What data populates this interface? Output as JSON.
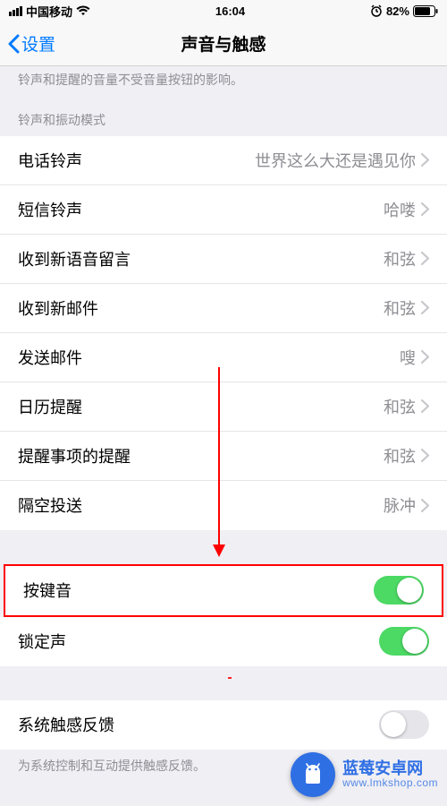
{
  "status": {
    "carrier": "中国移动",
    "time": "16:04",
    "battery_pct": "82%"
  },
  "nav": {
    "back_label": "设置",
    "title": "声音与触感"
  },
  "desc_top": "铃声和提醒的音量不受音量按钮的影响。",
  "section1_header": "铃声和振动模式",
  "rows": {
    "ringtone": {
      "label": "电话铃声",
      "value": "世界这么大还是遇见你"
    },
    "text_tone": {
      "label": "短信铃声",
      "value": "哈喽"
    },
    "voicemail": {
      "label": "收到新语音留言",
      "value": "和弦"
    },
    "new_mail": {
      "label": "收到新邮件",
      "value": "和弦"
    },
    "sent_mail": {
      "label": "发送邮件",
      "value": "嗖"
    },
    "calendar": {
      "label": "日历提醒",
      "value": "和弦"
    },
    "reminders": {
      "label": "提醒事项的提醒",
      "value": "和弦"
    },
    "airdrop": {
      "label": "隔空投送",
      "value": "脉冲"
    }
  },
  "toggles": {
    "keyboard_clicks": {
      "label": "按键音",
      "on": true
    },
    "lock_sound": {
      "label": "锁定声",
      "on": true
    },
    "system_haptics": {
      "label": "系统触感反馈",
      "on": false
    }
  },
  "footer_note": "为系统控制和互动提供触感反馈。",
  "watermark": {
    "title": "蓝莓安卓网",
    "url": "www.lmkshop.com"
  }
}
